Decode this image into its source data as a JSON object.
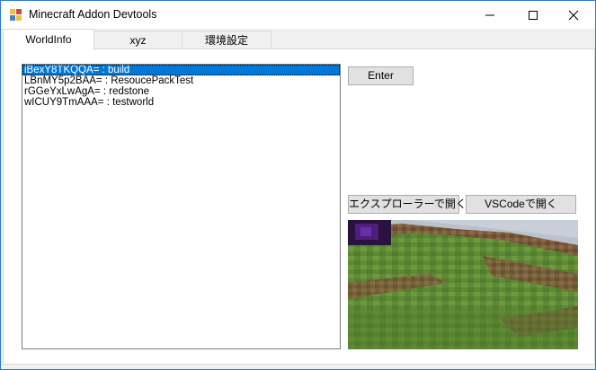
{
  "window": {
    "title": "Minecraft Addon Devtools"
  },
  "tabs": [
    {
      "label": "WorldInfo",
      "active": true
    },
    {
      "label": "xyz",
      "active": false
    },
    {
      "label": "環境設定",
      "active": false
    }
  ],
  "worlds": {
    "items": [
      {
        "label": "iBexY8TKQQA= : build",
        "selected": true
      },
      {
        "label": "LBnMY5p2BAA= : ResoucePackTest",
        "selected": false
      },
      {
        "label": "rGGeYxLwAgA= : redstone",
        "selected": false
      },
      {
        "label": "wICUY9TmAAA= : testworld",
        "selected": false
      }
    ]
  },
  "buttons": {
    "enter": "Enter",
    "open_explorer": "エクスプローラーで開く",
    "open_vscode": "VSCodeで開く"
  },
  "colors": {
    "selection": "#0078d7",
    "window_border": "#2b79d8",
    "grass": "#5f8a35",
    "dirt": "#7a5a3a",
    "obsidian": "#2a123f"
  }
}
